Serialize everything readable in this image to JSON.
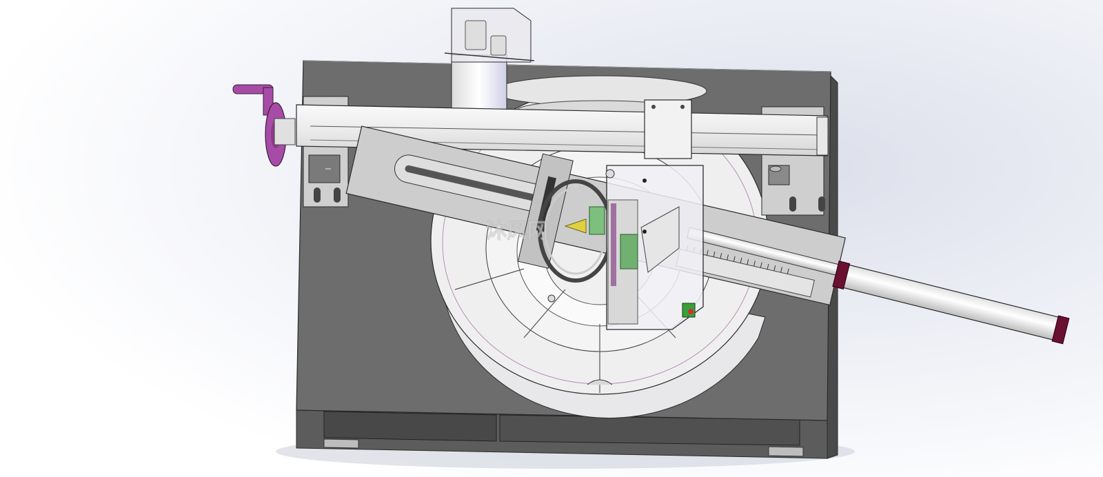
{
  "viewport": {
    "background_colors": [
      "#ffffff",
      "#eef0f6",
      "#dfe2ec",
      "#f3f4f8"
    ]
  },
  "model": {
    "colors": {
      "base_dark": "#6d6d6d",
      "base_light": "#c9c9c9",
      "metal_light": "#efefef",
      "handwheel": "#a64ca6",
      "cylinder_cap": "#6a1030",
      "edge": "#2a2a2a"
    },
    "watermark_text": "沐风网"
  }
}
